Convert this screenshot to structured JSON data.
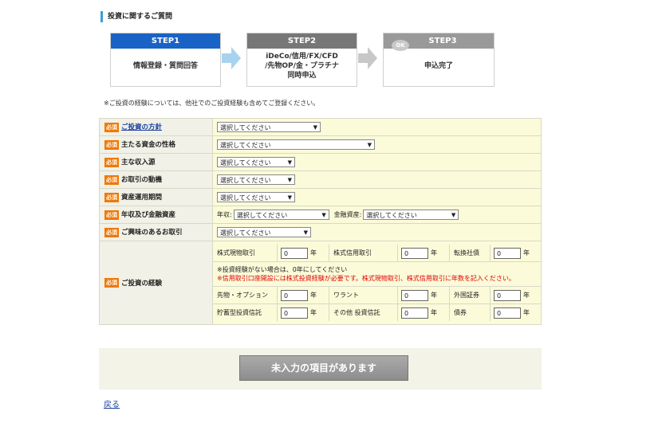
{
  "section_title": "投資に関するご質問",
  "steps": [
    {
      "head": "STEP1",
      "lines": [
        "情報登録・質問回答"
      ],
      "active": true
    },
    {
      "head": "STEP2",
      "lines": [
        "iDeCo/信用/FX/CFD",
        "/先物OP/金・プラチナ",
        "同時申込"
      ],
      "active": false
    },
    {
      "head": "STEP3",
      "lines": [
        "申込完了"
      ],
      "active": false,
      "badge": "OK"
    }
  ],
  "note": "※ご投資の経験については、他社でのご投資経験も含めてご登録ください。",
  "required_badge": "必須",
  "select_placeholder": "選択してください",
  "rows": {
    "policy": "ご投資の方針",
    "funds": "主たる資金の性格",
    "income": "主な収入源",
    "motive": "お取引の動機",
    "period": "資産運用期間",
    "income_assets": "年収及び金融資産",
    "interest": "ご興味のあるお取引",
    "experience": "ご投資の経験"
  },
  "income_assets": {
    "annual_label": "年収:",
    "assets_label": "金融資産:"
  },
  "experience": {
    "unit": "年",
    "row1": [
      {
        "label": "株式現物取引",
        "value": "0"
      },
      {
        "label": "株式信用取引",
        "value": "0"
      },
      {
        "label": "転換社債",
        "value": "0"
      }
    ],
    "note1": "※投資経験がない場合は、0年にしてください",
    "note2": "※信用取引口座開設には株式投資経験が必要です。株式現物取引、株式信用取引に年数を記入ください。",
    "row2": [
      {
        "label": "先物・オプション",
        "value": "0"
      },
      {
        "label": "ワラント",
        "value": "0"
      },
      {
        "label": "外国証券",
        "value": "0"
      }
    ],
    "row3": [
      {
        "label": "貯蓄型投資信託",
        "value": "0"
      },
      {
        "label": "その他 投資信託",
        "value": "0"
      },
      {
        "label": "債券",
        "value": "0"
      }
    ]
  },
  "submit_label": "未入力の項目があります",
  "back_label": "戻る"
}
